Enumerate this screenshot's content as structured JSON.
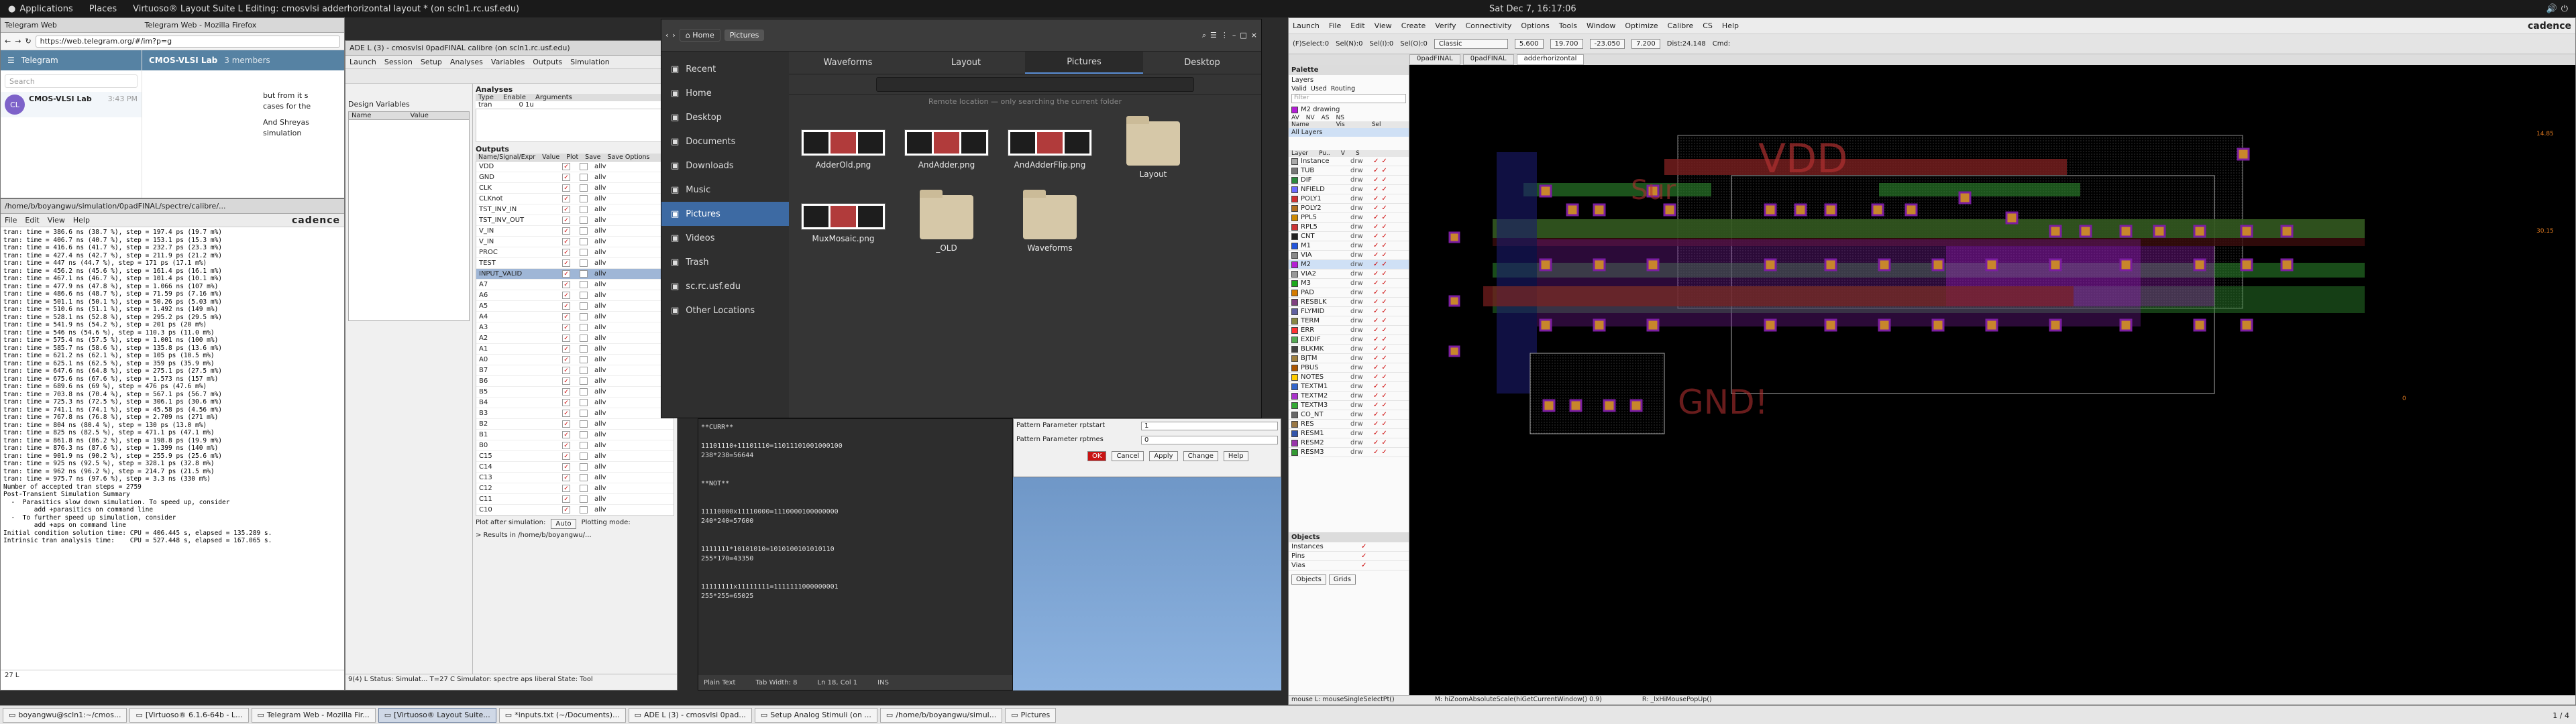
{
  "topbar": {
    "apps": "Applications",
    "places": "Places",
    "app_title": "Virtuoso® Layout Suite L Editing: cmosvlsi adderhorizontal layout * (on scln1.rc.usf.edu)",
    "clock": "Sat Dec 7, 16:17:06"
  },
  "firefox": {
    "tab1": "Telegram Web",
    "tab2": "Telegram Web - Mozilla Firefox",
    "url": "https://web.telegram.org/#/im?p=g",
    "telegram": "Telegram",
    "chat": "CMOS-VLSI Lab",
    "members": "3 members",
    "search_ph": "Search",
    "chat_name": "CMOS-VLSI Lab",
    "chat_time": "3:43 PM",
    "msg1": "but from it s",
    "msg2": "cases for the",
    "msg3": "And Shreyas",
    "msg4": "simulation"
  },
  "terminal": {
    "title": "/home/b/boyangwu/simulation/0padFINAL/spectre/calibre/...",
    "menu": [
      "File",
      "Edit",
      "View",
      "Help"
    ],
    "brand": "cadence",
    "lines": [
      "tran: time = 386.6 ns (38.7 %), step = 197.4 ps (19.7 m%)",
      "tran: time = 406.7 ns (40.7 %), step = 153.1 ps (15.3 m%)",
      "tran: time = 416.6 ns (41.7 %), step = 232.7 ps (23.3 m%)",
      "tran: time = 427.4 ns (42.7 %), step = 211.9 ps (21.2 m%)",
      "tran: time = 447 ns (44.7 %), step = 171 ps (17.1 m%)",
      "tran: time = 456.2 ns (45.6 %), step = 161.4 ps (16.1 m%)",
      "tran: time = 467.1 ns (46.7 %), step = 101.4 ps (10.1 m%)",
      "tran: time = 477.9 ns (47.8 %), step = 1.066 ns (107 m%)",
      "tran: time = 486.6 ns (48.7 %), step = 71.59 ps (7.16 m%)",
      "tran: time = 501.1 ns (50.1 %), step = 50.26 ps (5.03 m%)",
      "tran: time = 510.6 ns (51.1 %), step = 1.492 ns (149 m%)",
      "tran: time = 528.1 ns (52.8 %), step = 295.2 ps (29.5 m%)",
      "tran: time = 541.9 ns (54.2 %), step = 201 ps (20 m%)",
      "tran: time = 546 ns (54.6 %), step = 110.3 ps (11.0 m%)",
      "tran: time = 575.4 ns (57.5 %), step = 1.001 ns (100 m%)",
      "tran: time = 585.7 ns (58.6 %), step = 135.8 ps (13.6 m%)",
      "tran: time = 621.2 ns (62.1 %), step = 105 ps (10.5 m%)",
      "tran: time = 625.1 ns (62.5 %), step = 359 ps (35.9 m%)",
      "tran: time = 647.6 ns (64.8 %), step = 275.1 ps (27.5 m%)",
      "tran: time = 675.6 ns (67.6 %), step = 1.573 ns (157 m%)",
      "tran: time = 689.6 ns (69 %), step = 476 ps (47.6 m%)",
      "tran: time = 703.8 ns (70.4 %), step = 567.1 ps (56.7 m%)",
      "tran: time = 725.3 ns (72.5 %), step = 306.1 ps (30.6 m%)",
      "tran: time = 741.1 ns (74.1 %), step = 45.58 ps (4.56 m%)",
      "tran: time = 767.8 ns (76.8 %), step = 2.709 ns (271 m%)",
      "tran: time = 804 ns (80.4 %), step = 130 ps (13.0 m%)",
      "tran: time = 825 ns (82.5 %), step = 471.1 ps (47.1 m%)",
      "tran: time = 861.8 ns (86.2 %), step = 198.8 ps (19.9 m%)",
      "tran: time = 876.3 ns (87.6 %), step = 1.399 ns (140 m%)",
      "tran: time = 901.9 ns (90.2 %), step = 255.9 ps (25.6 m%)",
      "tran: time = 925 ns (92.5 %), step = 328.1 ps (32.8 m%)",
      "tran: time = 962 ns (96.2 %), step = 214.7 ps (21.5 m%)",
      "tran: time = 975.7 ns (97.6 %), step = 3.3 ns (330 m%)",
      "Number of accepted tran steps = 2759",
      "",
      "Post-Transient Simulation Summary",
      "",
      "  -  Parasitics slow down simulation. To speed up, consider",
      "        add +parasitics on command line",
      "  -  To further speed up simulation, consider",
      "        add +aps on command line",
      "",
      "Initial condition solution time: CPU = 406.445 s, elapsed = 135.289 s.",
      "Intrinsic tran analysis time:    CPU = 527.448 s, elapsed = 167.065 s."
    ],
    "status": "27  L"
  },
  "ade": {
    "title": "ADE L (3) - cmosvlsi 0padFINAL calibre (on scln1.rc.usf.edu)",
    "menu": [
      "Launch",
      "Session",
      "Setup",
      "Analyses",
      "Variables",
      "Outputs",
      "Simulation"
    ],
    "design_vars": "Design Variables",
    "col_name": "Name",
    "col_value": "Value",
    "analyses": "Analyses",
    "an_cols": [
      "Type",
      "Enable",
      "Arguments"
    ],
    "an_row": [
      "tran",
      "0 1u"
    ],
    "outputs": "Outputs",
    "out_cols": [
      "Name/Signal/Expr",
      "Value",
      "Plot",
      "Save",
      "Save Options"
    ],
    "signals": [
      "VDD",
      "GND",
      "CLK",
      "CLKnot",
      "TST_INV_IN",
      "TST_INV_OUT",
      "V_IN",
      "V_IN",
      "PROC",
      "TEST",
      "INPUT_VALID",
      "A7",
      "A6",
      "A5",
      "A4",
      "A3",
      "A2",
      "A1",
      "A0",
      "B7",
      "B6",
      "B5",
      "B4",
      "B3",
      "B2",
      "B1",
      "B0",
      "C15",
      "C14",
      "C13",
      "C12",
      "C11",
      "C10"
    ],
    "save_opt": "allv",
    "plot_after": "Plot after simulation:",
    "plot_auto": "Auto",
    "plotting_mode": "Plotting mode:",
    "results": "> Results in /home/b/boyangwu/...",
    "status": "9(4)  L  Status: Simulat...  T=27 C  Simulator: spectre  aps  liberal  State: Tool"
  },
  "filemanager": {
    "home": "Home",
    "path": "Pictures",
    "tabs": [
      "Waveforms",
      "Layout",
      "Pictures",
      "Desktop"
    ],
    "remote_msg": "Remote location — only searching the current folder",
    "side": [
      "Recent",
      "Home",
      "Desktop",
      "Documents",
      "Downloads",
      "Music",
      "Pictures",
      "Videos",
      "Trash",
      "sc.rc.usf.edu",
      "Other Locations"
    ],
    "files": [
      "AdderOld.png",
      "AndAdder.png",
      "AndAdderFlip.png",
      "Layout",
      "MuxMosaic.png",
      "_OLD",
      "Waveforms"
    ]
  },
  "editor": {
    "lines": [
      "**CURR**",
      "",
      "11101110+11101110=11011101001000100",
      "238*238=56644",
      "",
      "",
      "**NOT**",
      "",
      "",
      "11110000x11110000=1110000100000000",
      "240*240=57600",
      "",
      "",
      "1111111*10101010=1010100101010110",
      "255*170=43350",
      "",
      "",
      "11111111x11111111=1111111000000001",
      "255*255=65025"
    ],
    "status": [
      "Plain Text",
      "Tab Width: 8",
      "Ln 18, Col 1",
      "INS"
    ]
  },
  "props": {
    "row1": "Pattern Parameter rptstart",
    "row1v": "1",
    "row2": "Pattern Parameter rptmes",
    "row2v": "0",
    "ok": "OK",
    "cancel": "Cancel",
    "apply": "Apply",
    "change": "Change",
    "help": "Help"
  },
  "virtuoso": {
    "menu": [
      "Launch",
      "File",
      "Edit",
      "View",
      "Create",
      "Verify",
      "Connectivity",
      "Options",
      "Tools",
      "Window",
      "Optimize",
      "Calibre",
      "CS",
      "Help"
    ],
    "brand": "cadence",
    "select": "(F)Select:0",
    "sel": "Sel(N):0",
    "sel2": "Sel(I):0",
    "sel3": "Sel(O):0",
    "x": "X: 4.545",
    "y": "Y: -0.885",
    "dx": "dX:",
    "dy": "dY:",
    "dist": "Dist:",
    "cmd": "Cmd:",
    "classic": "Classic",
    "coords": [
      "5.600",
      "19.700",
      "-23.050",
      "7.200",
      "Dist:24.148"
    ],
    "tabs": [
      "0padFINAL",
      "0padFINAL",
      "adderhorizontal"
    ],
    "palette": "Palette",
    "layers": "Layers",
    "valid": "Valid",
    "used": "Used",
    "routing": "Routing",
    "filter_ph": "Filter",
    "current_layer": "M2 drawing",
    "lpp_cols": [
      "AV",
      "NV",
      "AS",
      "NS"
    ],
    "name_col": "Name",
    "vis_col": "Vis",
    "sel_col": "Sel",
    "all_layers": "All Layers",
    "layer_cols": [
      "Layer",
      "Pu..",
      "V",
      "S"
    ],
    "layer_list": [
      {
        "n": "Instance",
        "c": "#aaaaaa"
      },
      {
        "n": "TUB",
        "c": "#777777"
      },
      {
        "n": "DIF",
        "c": "#2b8a3e"
      },
      {
        "n": "NFIELD",
        "c": "#6b6bff"
      },
      {
        "n": "POLY1",
        "c": "#d03030"
      },
      {
        "n": "POLY2",
        "c": "#b07020"
      },
      {
        "n": "PPL5",
        "c": "#cc8800"
      },
      {
        "n": "RPL5",
        "c": "#cc3333"
      },
      {
        "n": "CNT",
        "c": "#222222"
      },
      {
        "n": "M1",
        "c": "#2255dd"
      },
      {
        "n": "VIA",
        "c": "#888888"
      },
      {
        "n": "M2",
        "c": "#b41ed6"
      },
      {
        "n": "VIA2",
        "c": "#999999"
      },
      {
        "n": "M3",
        "c": "#1ca81c"
      },
      {
        "n": "PAD",
        "c": "#d47b00"
      },
      {
        "n": "RESBLK",
        "c": "#804080"
      },
      {
        "n": "FLYMID",
        "c": "#6060a0"
      },
      {
        "n": "TERM",
        "c": "#888844"
      },
      {
        "n": "ERR",
        "c": "#ff3333"
      },
      {
        "n": "EXDIF",
        "c": "#55aa55"
      },
      {
        "n": "BLKMK",
        "c": "#444444"
      },
      {
        "n": "BJTM",
        "c": "#a08040"
      },
      {
        "n": "PBUS",
        "c": "#aa5500"
      },
      {
        "n": "NOTES",
        "c": "#ffcc00"
      },
      {
        "n": "TEXTM1",
        "c": "#3366cc"
      },
      {
        "n": "TEXTM2",
        "c": "#aa33cc"
      },
      {
        "n": "TEXTM3",
        "c": "#33aa33"
      },
      {
        "n": "CO_NT",
        "c": "#666666"
      },
      {
        "n": "RES",
        "c": "#997744"
      },
      {
        "n": "RESM1",
        "c": "#3355aa"
      },
      {
        "n": "RESM2",
        "c": "#9933aa"
      },
      {
        "n": "RESM3",
        "c": "#339933"
      }
    ],
    "layer_purpose": "drw",
    "objects": "Objects",
    "obj_list": [
      "Instances",
      "Pins",
      "Vias"
    ],
    "obj_tabs": [
      "Objects",
      "Grids"
    ],
    "coord_lbls": [
      "14.85",
      "30.15",
      "0"
    ],
    "status_mouse": "M: hiZoomAbsoluteScale(hiGetCurrentWindow() 0.9)",
    "status_r": "R: _lxHiMousePopUp()",
    "status_l": "mouse L: mouseSingleSelectPt()",
    "status_left": "1(78)",
    "status_cmd": "Cmd:",
    "sur_text": "Sur",
    "vdd_text": "VDD",
    "gnd_text": "GND!"
  },
  "taskbar": [
    "boyangwu@scln1:~/cmos...",
    "[Virtuoso® 6.1.6-64b - L...",
    "Telegram Web - Mozilla Fir...",
    "[Virtuoso® Layout Suite...",
    "*inputs.txt (~/Documents)...",
    "ADE L (3) - cmosvlsi 0pad...",
    "Setup Analog Stimuli (on ...",
    "/home/b/boyangwu/simul...",
    "Pictures"
  ],
  "taskbar_page": "1 / 4"
}
